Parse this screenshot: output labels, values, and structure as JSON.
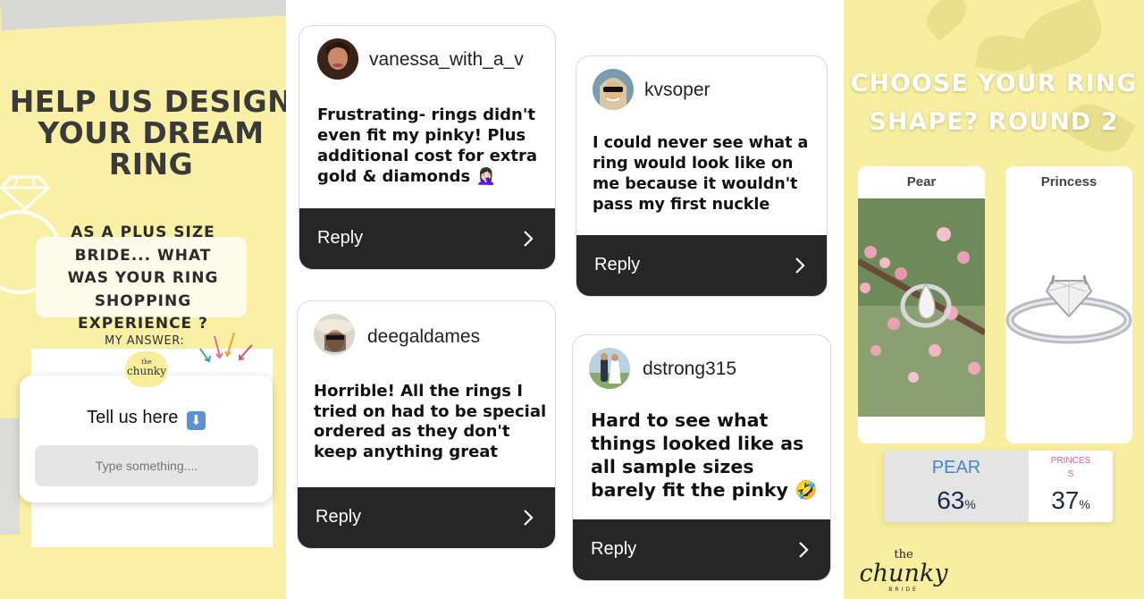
{
  "story_left": {
    "headline": "HELP US DESIGN YOUR DREAM RING",
    "question": "AS A PLUS SIZE BRIDE... WHAT WAS YOUR RING SHOPPING EXPERIENCE ?",
    "my_answer_label": "MY ANSWER:",
    "logo_small": "the",
    "logo_big": "chunky",
    "logo_tiny": "BRIDE",
    "question_box": {
      "title": "Tell us here",
      "title_icon": "down-arrow-emoji-icon",
      "placeholder": "Type something...."
    }
  },
  "messages": [
    {
      "username": "vanessa_with_a_v",
      "text": "Frustrating- rings didn't even fit my pinky! Plus additional cost for extra gold & diamonds 🤦🏻‍♀️",
      "reply_label": "Reply"
    },
    {
      "username": "deegaldames",
      "text": "Horrible! All the rings I tried on had to be special ordered as they don't keep anything great",
      "reply_label": "Reply"
    },
    {
      "username": "kvsoper",
      "text": "I could never see what a ring would look like on me because it wouldn't pass my first nuckle",
      "reply_label": "Reply"
    },
    {
      "username": "dstrong315",
      "text": "Hard to see what things looked like as all sample sizes barely fit the pinky 🤣",
      "reply_label": "Reply"
    }
  ],
  "story_right": {
    "title": "CHOOSE YOUR RING SHAPE? ROUND 2",
    "options": [
      {
        "label": "Pear",
        "image": "pear-ring-photo"
      },
      {
        "label": "Princess",
        "image": "princess-ring-photo"
      }
    ],
    "results": [
      {
        "name": "PEAR",
        "percent": "63",
        "unit": "%",
        "color": "#3e86d4"
      },
      {
        "name": "PRINCES S",
        "percent": "37",
        "unit": "%",
        "color": "#e2589a"
      }
    ],
    "brand": {
      "the": "the",
      "name": "chunky",
      "sub": "BRIDE"
    }
  },
  "colors": {
    "left_bg": "#faf0a5",
    "right_bg": "#f7ef9f",
    "reply_bar": "#262626",
    "pear_accent": "#3e86d4",
    "princess_accent": "#e2589a"
  }
}
